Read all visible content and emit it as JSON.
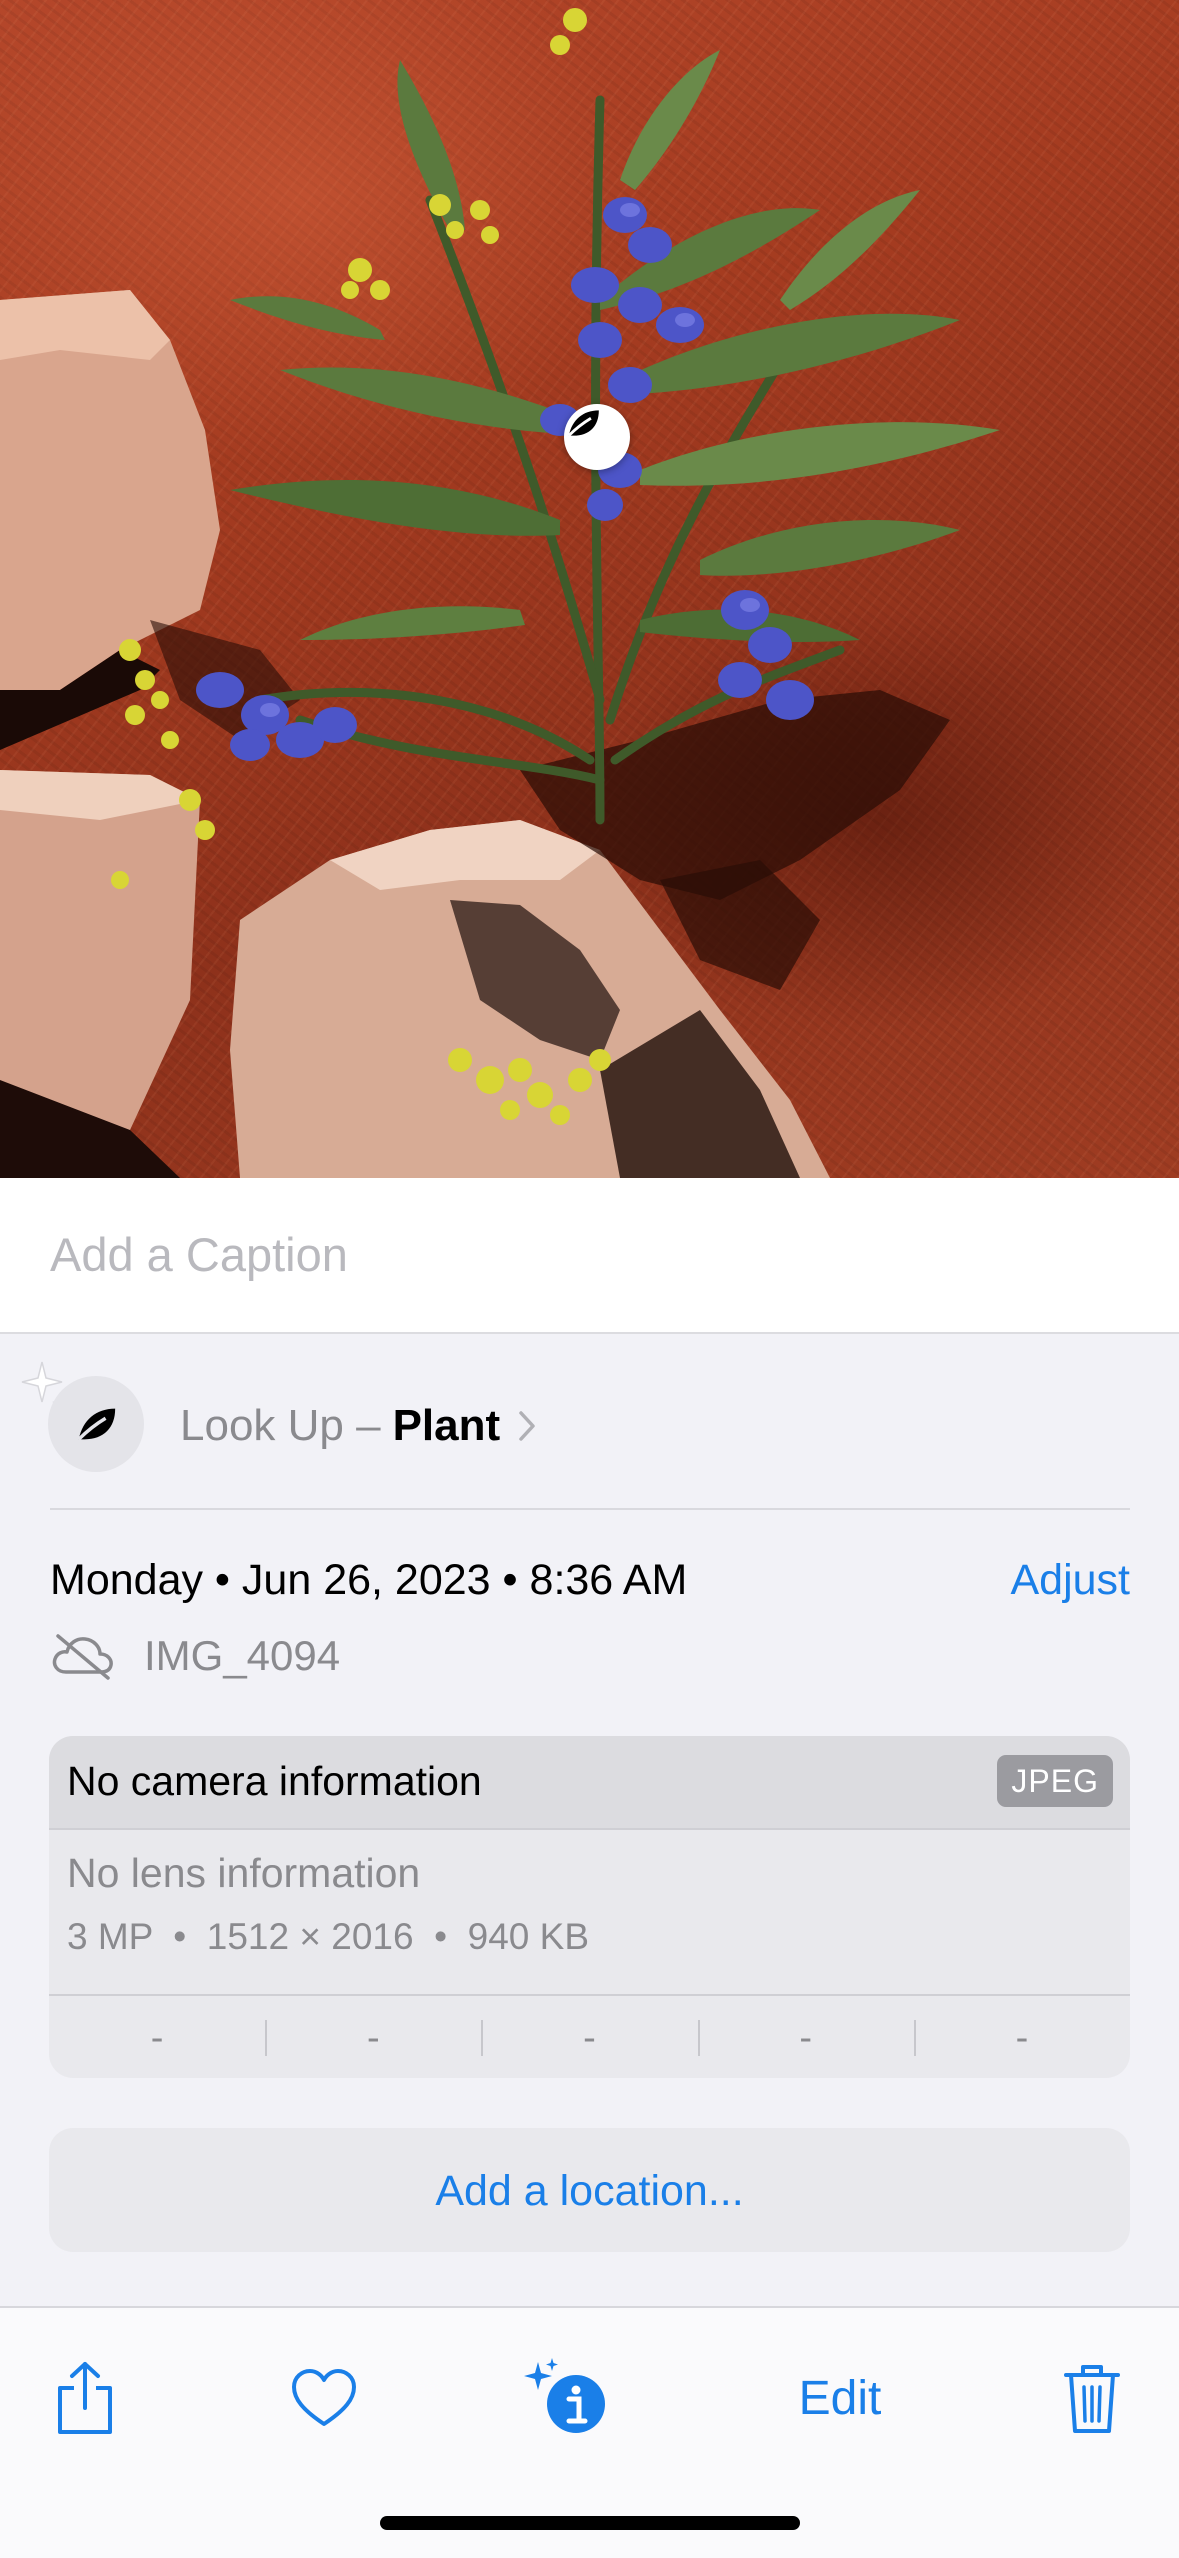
{
  "caption": {
    "placeholder": "Add a Caption"
  },
  "lookup": {
    "prefix": "Look Up –",
    "subject": "Plant",
    "icon": "leaf-icon"
  },
  "date": {
    "text": "Monday • Jun 26, 2023 • 8:36 AM",
    "adjust_label": "Adjust"
  },
  "file": {
    "name": "IMG_4094",
    "cloud_status_icon": "cloud-slash-icon"
  },
  "camera": {
    "title": "No camera information",
    "format": "JPEG",
    "lens": "No lens information",
    "specs": "3 MP  •  1512 × 2016  •  940 KB",
    "exif": [
      "-",
      "-",
      "-",
      "-",
      "-"
    ]
  },
  "location": {
    "label": "Add a location..."
  },
  "toolbar": {
    "share_icon": "share-icon",
    "favorite_icon": "heart-icon",
    "info_icon": "info-sparkle-icon",
    "edit_label": "Edit",
    "delete_icon": "trash-icon"
  },
  "colors": {
    "accent": "#1a7fe8",
    "secondary_text": "#8a8a8e",
    "soil": "#a43b20",
    "flower": "#4d55c8"
  }
}
